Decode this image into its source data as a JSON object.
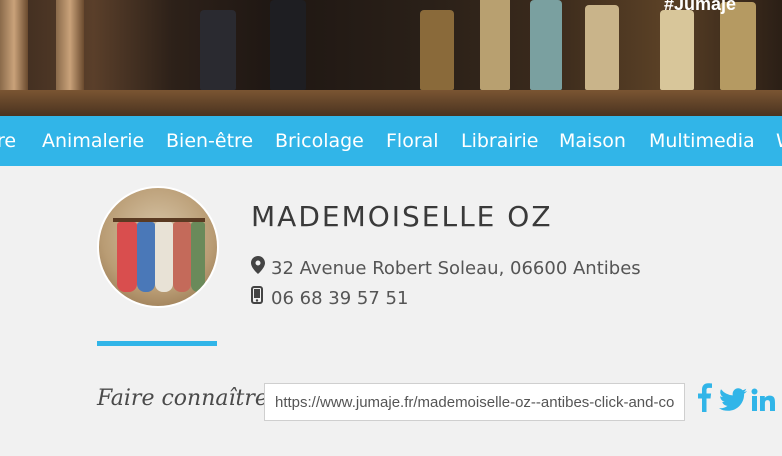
{
  "hero": {
    "tag": "#Jumaje"
  },
  "nav": {
    "items": [
      "re",
      "Animalerie",
      "Bien-être",
      "Bricolage",
      "Floral",
      "Librairie",
      "Maison",
      "Multimedia",
      "W"
    ]
  },
  "shop": {
    "name": "MADEMOISELLE OZ",
    "address": "32 Avenue Robert Soleau, 06600 Antibes",
    "phone": "06 68 39 57 51"
  },
  "share": {
    "label": "Faire connaître :",
    "url": "https://www.jumaje.fr/mademoiselle-oz--antibes-click-and-collect"
  },
  "social": {
    "icons": [
      "facebook-icon",
      "twitter-icon",
      "linkedin-icon"
    ]
  },
  "colors": {
    "accent": "#31b5e8",
    "background": "#f1f1f1",
    "title": "#3a3a3a"
  }
}
